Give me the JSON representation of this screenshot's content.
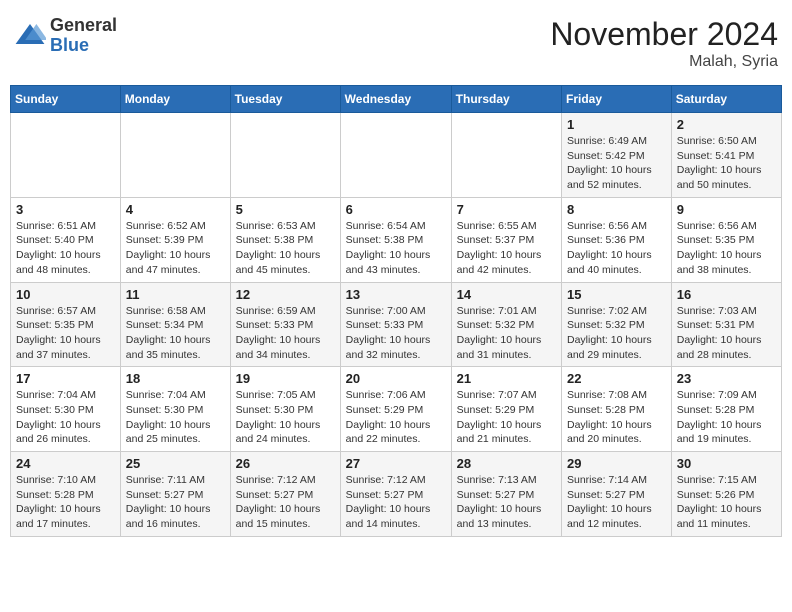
{
  "header": {
    "logo_general": "General",
    "logo_blue": "Blue",
    "month_title": "November 2024",
    "location": "Malah, Syria"
  },
  "days_of_week": [
    "Sunday",
    "Monday",
    "Tuesday",
    "Wednesday",
    "Thursday",
    "Friday",
    "Saturday"
  ],
  "weeks": [
    [
      {
        "day": "",
        "info": ""
      },
      {
        "day": "",
        "info": ""
      },
      {
        "day": "",
        "info": ""
      },
      {
        "day": "",
        "info": ""
      },
      {
        "day": "",
        "info": ""
      },
      {
        "day": "1",
        "info": "Sunrise: 6:49 AM\nSunset: 5:42 PM\nDaylight: 10 hours\nand 52 minutes."
      },
      {
        "day": "2",
        "info": "Sunrise: 6:50 AM\nSunset: 5:41 PM\nDaylight: 10 hours\nand 50 minutes."
      }
    ],
    [
      {
        "day": "3",
        "info": "Sunrise: 6:51 AM\nSunset: 5:40 PM\nDaylight: 10 hours\nand 48 minutes."
      },
      {
        "day": "4",
        "info": "Sunrise: 6:52 AM\nSunset: 5:39 PM\nDaylight: 10 hours\nand 47 minutes."
      },
      {
        "day": "5",
        "info": "Sunrise: 6:53 AM\nSunset: 5:38 PM\nDaylight: 10 hours\nand 45 minutes."
      },
      {
        "day": "6",
        "info": "Sunrise: 6:54 AM\nSunset: 5:38 PM\nDaylight: 10 hours\nand 43 minutes."
      },
      {
        "day": "7",
        "info": "Sunrise: 6:55 AM\nSunset: 5:37 PM\nDaylight: 10 hours\nand 42 minutes."
      },
      {
        "day": "8",
        "info": "Sunrise: 6:56 AM\nSunset: 5:36 PM\nDaylight: 10 hours\nand 40 minutes."
      },
      {
        "day": "9",
        "info": "Sunrise: 6:56 AM\nSunset: 5:35 PM\nDaylight: 10 hours\nand 38 minutes."
      }
    ],
    [
      {
        "day": "10",
        "info": "Sunrise: 6:57 AM\nSunset: 5:35 PM\nDaylight: 10 hours\nand 37 minutes."
      },
      {
        "day": "11",
        "info": "Sunrise: 6:58 AM\nSunset: 5:34 PM\nDaylight: 10 hours\nand 35 minutes."
      },
      {
        "day": "12",
        "info": "Sunrise: 6:59 AM\nSunset: 5:33 PM\nDaylight: 10 hours\nand 34 minutes."
      },
      {
        "day": "13",
        "info": "Sunrise: 7:00 AM\nSunset: 5:33 PM\nDaylight: 10 hours\nand 32 minutes."
      },
      {
        "day": "14",
        "info": "Sunrise: 7:01 AM\nSunset: 5:32 PM\nDaylight: 10 hours\nand 31 minutes."
      },
      {
        "day": "15",
        "info": "Sunrise: 7:02 AM\nSunset: 5:32 PM\nDaylight: 10 hours\nand 29 minutes."
      },
      {
        "day": "16",
        "info": "Sunrise: 7:03 AM\nSunset: 5:31 PM\nDaylight: 10 hours\nand 28 minutes."
      }
    ],
    [
      {
        "day": "17",
        "info": "Sunrise: 7:04 AM\nSunset: 5:30 PM\nDaylight: 10 hours\nand 26 minutes."
      },
      {
        "day": "18",
        "info": "Sunrise: 7:04 AM\nSunset: 5:30 PM\nDaylight: 10 hours\nand 25 minutes."
      },
      {
        "day": "19",
        "info": "Sunrise: 7:05 AM\nSunset: 5:30 PM\nDaylight: 10 hours\nand 24 minutes."
      },
      {
        "day": "20",
        "info": "Sunrise: 7:06 AM\nSunset: 5:29 PM\nDaylight: 10 hours\nand 22 minutes."
      },
      {
        "day": "21",
        "info": "Sunrise: 7:07 AM\nSunset: 5:29 PM\nDaylight: 10 hours\nand 21 minutes."
      },
      {
        "day": "22",
        "info": "Sunrise: 7:08 AM\nSunset: 5:28 PM\nDaylight: 10 hours\nand 20 minutes."
      },
      {
        "day": "23",
        "info": "Sunrise: 7:09 AM\nSunset: 5:28 PM\nDaylight: 10 hours\nand 19 minutes."
      }
    ],
    [
      {
        "day": "24",
        "info": "Sunrise: 7:10 AM\nSunset: 5:28 PM\nDaylight: 10 hours\nand 17 minutes."
      },
      {
        "day": "25",
        "info": "Sunrise: 7:11 AM\nSunset: 5:27 PM\nDaylight: 10 hours\nand 16 minutes."
      },
      {
        "day": "26",
        "info": "Sunrise: 7:12 AM\nSunset: 5:27 PM\nDaylight: 10 hours\nand 15 minutes."
      },
      {
        "day": "27",
        "info": "Sunrise: 7:12 AM\nSunset: 5:27 PM\nDaylight: 10 hours\nand 14 minutes."
      },
      {
        "day": "28",
        "info": "Sunrise: 7:13 AM\nSunset: 5:27 PM\nDaylight: 10 hours\nand 13 minutes."
      },
      {
        "day": "29",
        "info": "Sunrise: 7:14 AM\nSunset: 5:27 PM\nDaylight: 10 hours\nand 12 minutes."
      },
      {
        "day": "30",
        "info": "Sunrise: 7:15 AM\nSunset: 5:26 PM\nDaylight: 10 hours\nand 11 minutes."
      }
    ]
  ]
}
